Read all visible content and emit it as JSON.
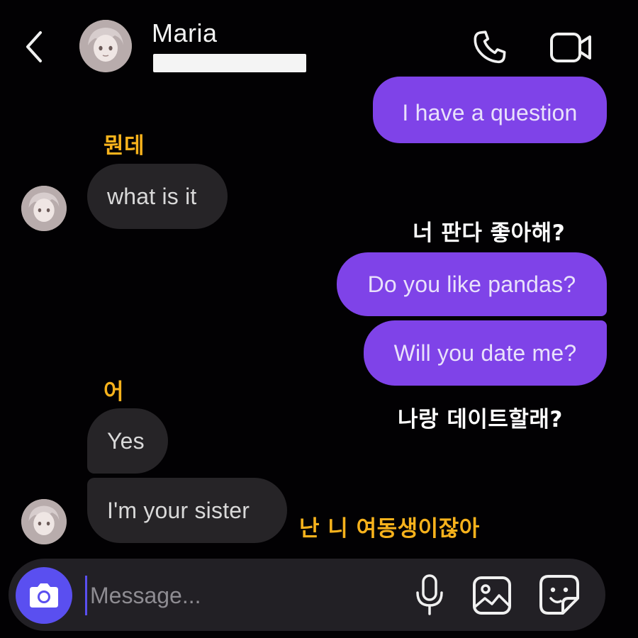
{
  "header": {
    "contact_name": "Maria",
    "back_icon": "chevron-left-icon",
    "call_icon": "phone-icon",
    "video_icon": "video-camera-icon"
  },
  "messages": [
    {
      "direction": "outgoing",
      "text": "I have a question"
    },
    {
      "direction": "incoming",
      "text": "what is it"
    },
    {
      "direction": "outgoing",
      "text": "Do you like pandas?"
    },
    {
      "direction": "outgoing",
      "text": "Will you date me?"
    },
    {
      "direction": "incoming",
      "text": "Yes"
    },
    {
      "direction": "incoming",
      "text": "I'm your sister"
    }
  ],
  "captions": [
    {
      "text": "뭔데",
      "color": "#f7b21c"
    },
    {
      "text": "너 판다 좋아해?",
      "color": "#ffffff"
    },
    {
      "text": "어",
      "color": "#f7b21c"
    },
    {
      "text": "나랑 데이트할래?",
      "color": "#ffffff"
    },
    {
      "text": "난 니 여동생이잖아",
      "color": "#f7b21c"
    }
  ],
  "composer": {
    "placeholder": "Message...",
    "camera_icon": "camera-icon",
    "mic_icon": "microphone-icon",
    "gallery_icon": "image-gallery-icon",
    "sticker_icon": "sticker-icon"
  },
  "colors": {
    "background": "#020103",
    "outgoing_bubble": "#7f43e8",
    "incoming_bubble": "#262427",
    "accent": "#5a4ff0"
  }
}
